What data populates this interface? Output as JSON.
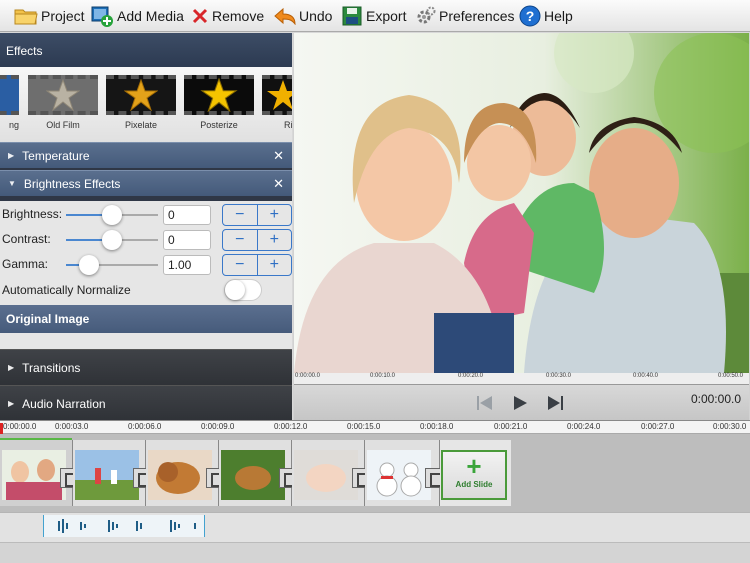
{
  "toolbar": {
    "project": "Project",
    "add_media": "Add Media",
    "remove": "Remove",
    "undo": "Undo",
    "export": "Export",
    "preferences": "Preferences",
    "help": "Help"
  },
  "effects_panel": {
    "title": "Effects",
    "items": [
      {
        "label": "ng",
        "icon": "film-icon"
      },
      {
        "label": "Old Film",
        "icon": "star-icon"
      },
      {
        "label": "Pixelate",
        "icon": "star-icon"
      },
      {
        "label": "Posterize",
        "icon": "star-icon"
      },
      {
        "label": "Ri",
        "icon": "star-icon"
      }
    ]
  },
  "sections": {
    "temperature": "Temperature",
    "brightness": "Brightness Effects",
    "original_image": "Original Image",
    "transitions": "Transitions",
    "audio_narration": "Audio Narration"
  },
  "brightness": {
    "brightness_label": "Brightness:",
    "brightness_value": "0",
    "contrast_label": "Contrast:",
    "contrast_value": "0",
    "gamma_label": "Gamma:",
    "gamma_value": "1.00",
    "auto_normalize_label": "Automatically Normalize",
    "auto_normalize_on": false,
    "minus": "−",
    "plus": "+"
  },
  "preview": {
    "ruler_ticks": [
      "0:00:00.0",
      "0:00:10.0",
      "0:00:20.0",
      "0:00:30.0",
      "0:00:40.0",
      "0:00:50.0"
    ],
    "time": "0:00:00.0"
  },
  "timeline": {
    "ticks": [
      "0:00:00.0",
      "0:00:03.0",
      "0:00:06.0",
      "0:00:09.0",
      "0:00:12.0",
      "0:00:15.0",
      "0:00:18.0",
      "0:00:21.0",
      "0:00:24.0",
      "0:00:27.0",
      "0:00:30.0"
    ],
    "slides": [
      "Family",
      "Running",
      "Dog",
      "Dog on grass",
      "Baby",
      "Snowmen"
    ],
    "add_slide": "Add Slide"
  },
  "colors": {
    "accent": "#3a78c9",
    "panel_header": "#3d4d66",
    "add_slide_green": "#3aa53a",
    "audio_wave": "#1f5d86"
  }
}
